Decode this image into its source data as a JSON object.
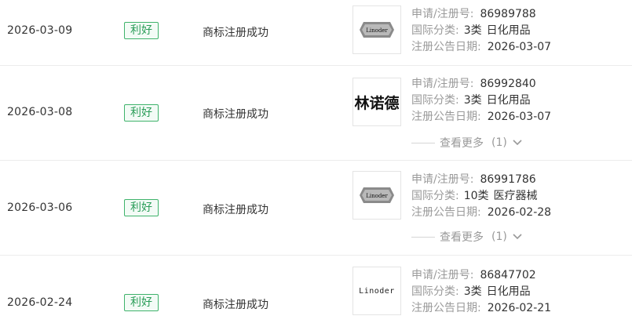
{
  "rows": [
    {
      "date": "2026-03-09",
      "badge": "利好",
      "event": "商标注册成功",
      "logo": "Linoder",
      "reg_label": "申请/注册号:",
      "reg_no": "86989788",
      "class_label": "国际分类:",
      "class_no": "3类",
      "class_name": "日化用品",
      "pub_label": "注册公告日期:",
      "pub_date": "2026-03-07"
    },
    {
      "date": "2026-03-08",
      "badge": "利好",
      "event": "商标注册成功",
      "logo": "林诺德",
      "reg_label": "申请/注册号:",
      "reg_no": "86992840",
      "class_label": "国际分类:",
      "class_no": "3类",
      "class_name": "日化用品",
      "pub_label": "注册公告日期:",
      "pub_date": "2026-03-07",
      "more_label": "查看更多",
      "more_count": "(1)"
    },
    {
      "date": "2026-03-06",
      "badge": "利好",
      "event": "商标注册成功",
      "logo": "Linoder",
      "reg_label": "申请/注册号:",
      "reg_no": "86991786",
      "class_label": "国际分类:",
      "class_no": "10类",
      "class_name": "医疗器械",
      "pub_label": "注册公告日期:",
      "pub_date": "2026-02-28",
      "more_label": "查看更多",
      "more_count": "(1)"
    },
    {
      "date": "2026-02-24",
      "badge": "利好",
      "event": "商标注册成功",
      "logo": "Linoder",
      "reg_label": "申请/注册号:",
      "reg_no": "86847702",
      "class_label": "国际分类:",
      "class_no": "3类",
      "class_name": "日化用品",
      "pub_label": "注册公告日期:",
      "pub_date": "2026-02-21"
    }
  ],
  "colors": {
    "badge_green": "#2a9d58",
    "label_gray": "#9a9a9a",
    "divider": "#ececec"
  }
}
